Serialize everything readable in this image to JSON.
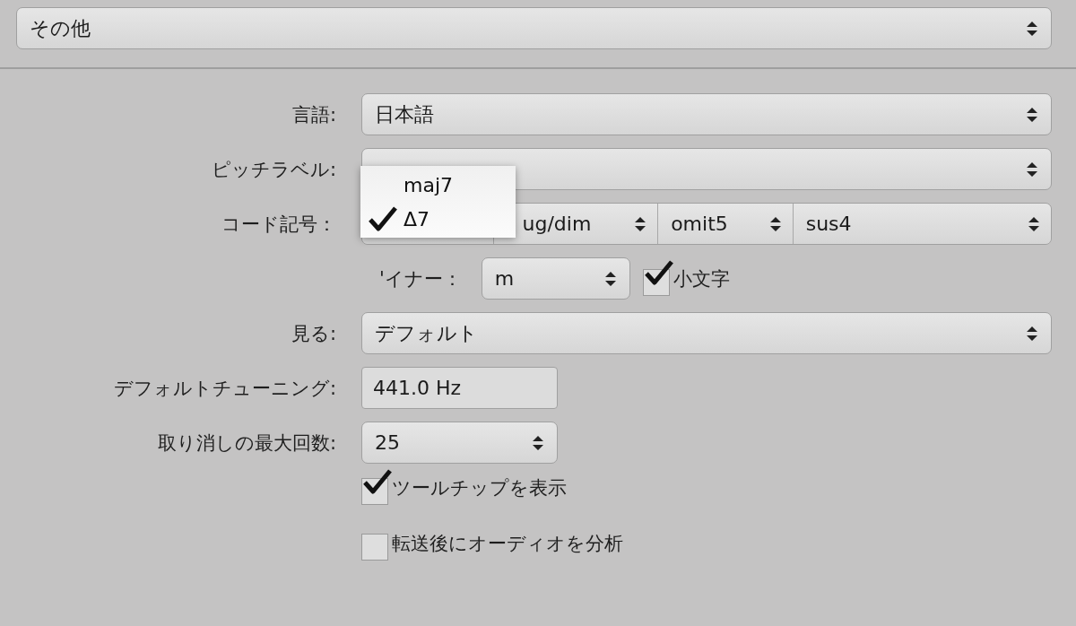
{
  "category": {
    "value": "その他"
  },
  "fields": [
    {
      "kind": "popup",
      "label": "言語:",
      "value": "日本語"
    },
    {
      "kind": "popup",
      "label": "ピッチラベル:"
    },
    {
      "kind": "segments",
      "label": "コード記号：",
      "segments": [
        {
          "kind": "blank"
        },
        {
          "kind": "popup",
          "value": "ug/dim"
        },
        {
          "kind": "popup",
          "value": "omit5"
        },
        {
          "kind": "popup",
          "value": "sus4"
        }
      ]
    },
    {
      "kind": "minor",
      "label": "'イナー：",
      "value": "m",
      "checkbox": {
        "label": "小文字",
        "checked": true
      }
    },
    {
      "kind": "popup",
      "label": "見る:",
      "value": "デフォルト"
    },
    {
      "kind": "text",
      "label": "デフォルトチューニング:",
      "value": "441.0 Hz"
    },
    {
      "kind": "short_popup",
      "label": "取り消しの最大回数:",
      "value": "25"
    },
    {
      "kind": "checkbox",
      "label": "ツールチップを表示",
      "checked": true
    },
    {
      "kind": "checkbox",
      "label": "転送後にオーディオを分析",
      "checked": false
    }
  ],
  "menu": {
    "items": [
      {
        "label": "maj7",
        "selected": false
      },
      {
        "label": "Δ7",
        "selected": true
      }
    ]
  }
}
